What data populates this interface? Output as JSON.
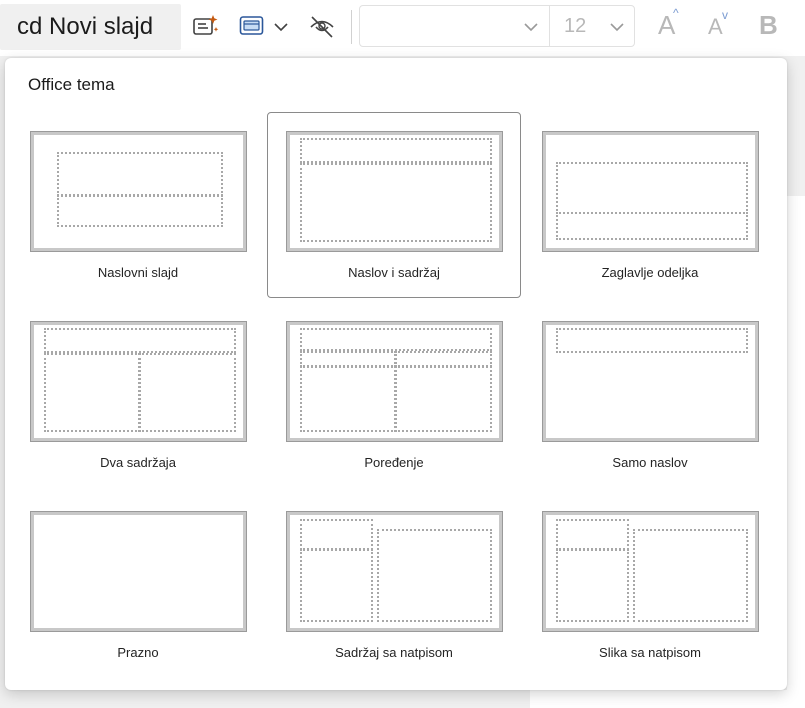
{
  "toolbar": {
    "new_slide_label": "cd Novi slajd",
    "font_name_value": "",
    "font_size_value": "12",
    "grow_label": "A",
    "shrink_label": "A",
    "bold_label": "B",
    "icons": [
      "designer-icon",
      "layout-icon",
      "chevron-down-icon",
      "hide-slide-icon"
    ]
  },
  "layouts_panel": {
    "title": "Office tema",
    "selected_index": 1,
    "layouts": [
      {
        "label": "Naslovni slajd"
      },
      {
        "label": "Naslov i sadržaj"
      },
      {
        "label": "Zaglavlje odeljka"
      },
      {
        "label": "Dva sadržaja"
      },
      {
        "label": "Poređenje"
      },
      {
        "label": "Samo naslov"
      },
      {
        "label": "Prazno"
      },
      {
        "label": "Sadržaj sa natpisom"
      },
      {
        "label": "Slika sa natpisom"
      }
    ]
  },
  "colors": {
    "accent_sparkle": "#c55a11",
    "icon_blue": "#2b579a",
    "font_arrow": "#7b9bd1"
  }
}
